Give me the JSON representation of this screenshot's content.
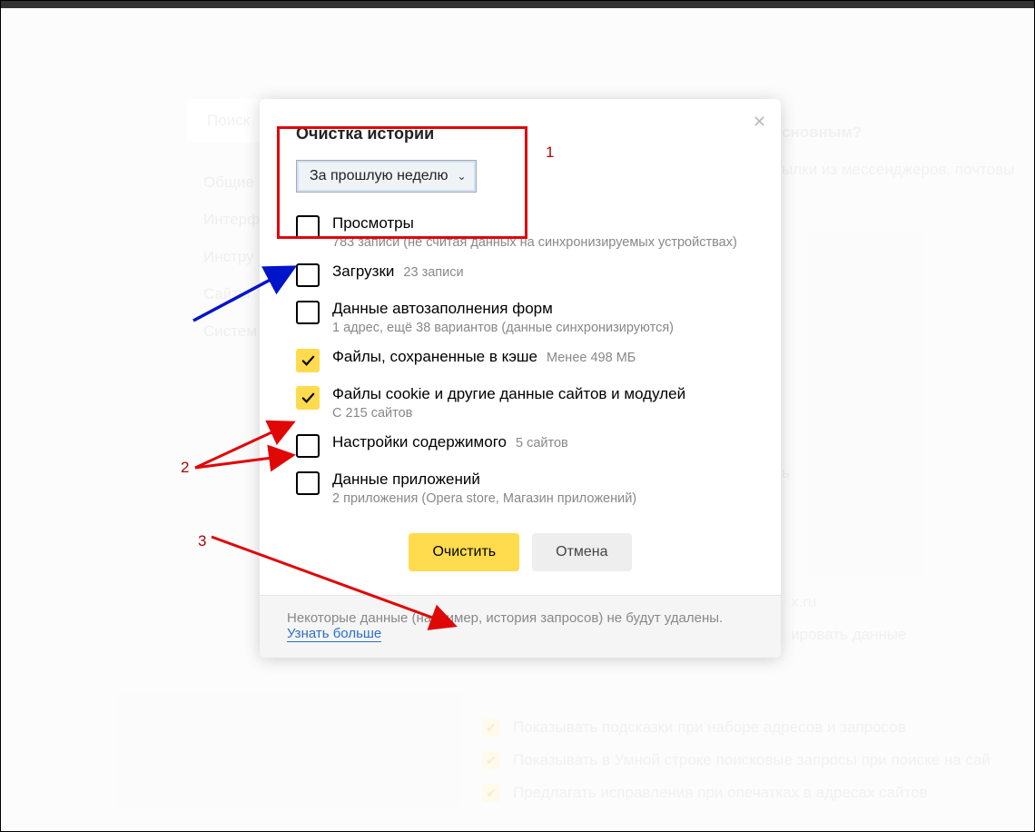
{
  "bg": {
    "search_placeholder": "Поиск",
    "nav": [
      "Общие",
      "Интерф",
      "Инстру",
      "Сайты",
      "Систем"
    ],
    "title_q": "сновным?",
    "line1": "ылки из мессенджеров, почтовы",
    "line_open": "ь",
    "line_xru": "x.ru",
    "line_sync": "ировать данные",
    "sugg1": "Показывать подсказки при наборе адресов и запросов",
    "sugg2": "Показывать в Умной строке поисковые запросы при поиске на сай",
    "sugg3": "Предлагать исправления при опечатках в адресах сайтов"
  },
  "dialog": {
    "title": "Очистка истории",
    "range": "За прошлую неделю",
    "options": [
      {
        "label": "Просмотры",
        "sub": "783 записи (не считая данных на синхронизируемых устройствах)",
        "checked": false,
        "inline_sub": ""
      },
      {
        "label": "Загрузки",
        "sub": "",
        "checked": false,
        "inline_sub": "23 записи"
      },
      {
        "label": "Данные автозаполнения форм",
        "sub": "1 адрес, ещё 38 вариантов (данные синхронизируются)",
        "checked": false,
        "inline_sub": ""
      },
      {
        "label": "Файлы, сохраненные в кэше",
        "sub": "",
        "checked": true,
        "inline_sub": "Менее 498 МБ"
      },
      {
        "label": "Файлы cookie и другие данные сайтов и модулей",
        "sub": "С 215 сайтов",
        "checked": true,
        "inline_sub": ""
      },
      {
        "label": "Настройки содержимого",
        "sub": "",
        "checked": false,
        "inline_sub": "5 сайтов"
      },
      {
        "label": "Данные приложений",
        "sub": "2 приложения (Opera store, Магазин приложений)",
        "checked": false,
        "inline_sub": ""
      }
    ],
    "clear_btn": "Очистить",
    "cancel_btn": "Отмена",
    "footer_note": "Некоторые данные (например, история запросов) не будут удалены.",
    "footer_link": "Узнать больше"
  },
  "anno": {
    "n1": "1",
    "n2": "2",
    "n3": "3"
  }
}
